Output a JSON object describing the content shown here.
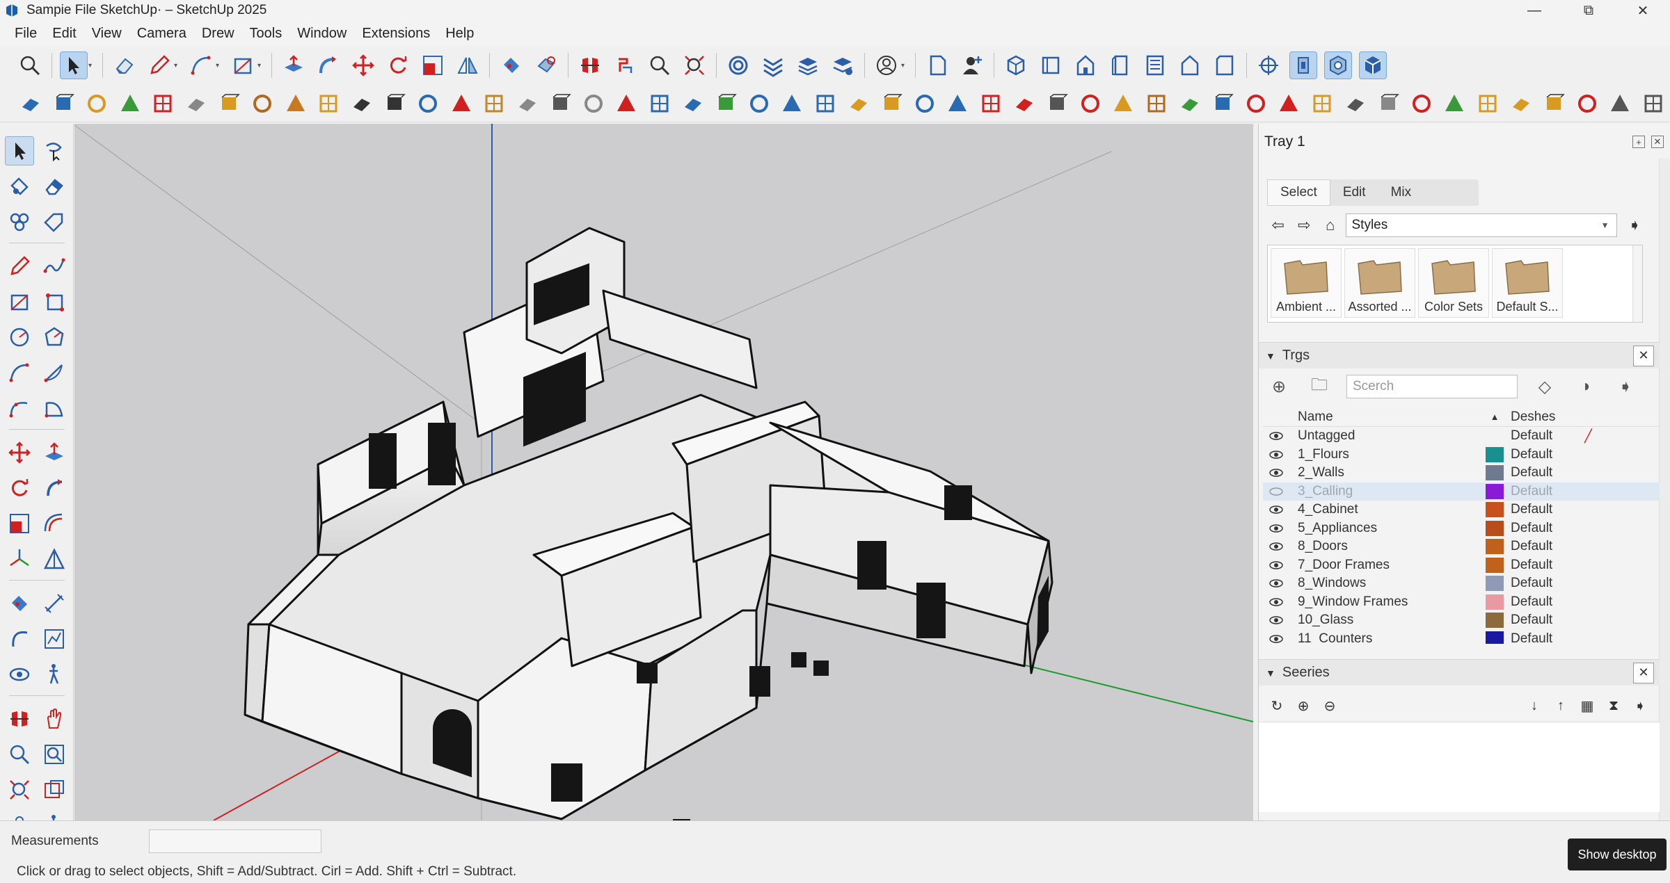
{
  "window": {
    "title": "Sampie File SketchUp· – SketchUp 2025",
    "minimize": "—",
    "maximize": "⧉",
    "close": "✕"
  },
  "menu": [
    "File",
    "Edit",
    "View",
    "Camera",
    "Drew",
    "Tools",
    "Window",
    "Extensions",
    "Help"
  ],
  "tray": {
    "title": "Tray 1",
    "styles": {
      "tabs": [
        "Select",
        "Edit",
        "Mix"
      ],
      "selected_tab": "Select",
      "dropdown_value": "Styles",
      "items": [
        "Ambient ...",
        "Assorted ...",
        "Color Sets",
        "Default S..."
      ]
    },
    "tags": {
      "title": "Trgs",
      "search_placeholder": "Scerch",
      "col_name": "Name",
      "col_dash": "Deshes",
      "rows": [
        {
          "name": "Untagged",
          "color": "",
          "dash": "Default",
          "visible": true,
          "dim": false
        },
        {
          "name": "1_Flours",
          "color": "#1a8f8f",
          "dash": "Default",
          "visible": true,
          "dim": false
        },
        {
          "name": "2_Walls",
          "color": "#6e7a8e",
          "dash": "Default",
          "visible": true,
          "dim": false
        },
        {
          "name": "3_Calling",
          "color": "#8a1ad6",
          "dash": "Default",
          "visible": false,
          "dim": true
        },
        {
          "name": "4_Cabinet",
          "color": "#c8501e",
          "dash": "Default",
          "visible": true,
          "dim": false
        },
        {
          "name": "5_Appliances",
          "color": "#b84c1a",
          "dash": "Default",
          "visible": true,
          "dim": false
        },
        {
          "name": "8_Doors",
          "color": "#c0601a",
          "dash": "Default",
          "visible": true,
          "dim": false
        },
        {
          "name": "7_Door Frames",
          "color": "#c0621c",
          "dash": "Default",
          "visible": true,
          "dim": false
        },
        {
          "name": "8_Windows",
          "color": "#8f9ab5",
          "dash": "Default",
          "visible": true,
          "dim": false
        },
        {
          "name": "9_Window Frames",
          "color": "#e89aa0",
          "dash": "Default",
          "visible": true,
          "dim": false
        },
        {
          "name": "10_Glass",
          "color": "#8c6a3c",
          "dash": "Default",
          "visible": true,
          "dim": false
        },
        {
          "name": "11_Counters",
          "color": "#1a1aa0",
          "dash": "Default",
          "visible": true,
          "dim": false
        }
      ]
    },
    "scenes": {
      "title": "Seeries"
    }
  },
  "status": {
    "measurements_label": "Measurements",
    "hint": "Click or drag to select objects, Shift = Add/Subtract. Cirl = Add. Shift + Ctrl = Subtract."
  },
  "taskbar": {
    "show_desktop": "Show desktop"
  },
  "colors": {
    "viewport_bg": "#cdcdd0",
    "accent": "#3a78c8"
  }
}
